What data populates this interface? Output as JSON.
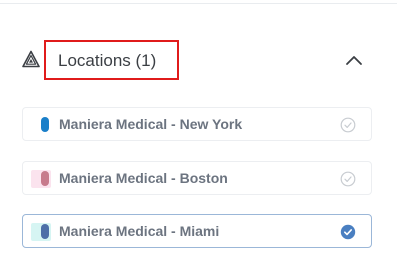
{
  "section": {
    "title": "Locations (1)",
    "icon": "triangle-warning-icon",
    "collapse_icon": "chevron-up-icon"
  },
  "locations": [
    {
      "label": "Maniera Medical - New York",
      "color": "#1a7fc9",
      "swatch_bg": "#ffffff",
      "selected": false
    },
    {
      "label": "Maniera Medical - Boston",
      "color": "#c77a8c",
      "swatch_bg": "#fbe3ee",
      "selected": false
    },
    {
      "label": "Maniera Medical - Miami",
      "color": "#4d6fa8",
      "swatch_bg": "#d6f5f3",
      "selected": true
    }
  ],
  "colors": {
    "highlight_border": "#e01b1b",
    "check_selected": "#4a7fc1",
    "check_unselected": "#c8ccd1"
  }
}
